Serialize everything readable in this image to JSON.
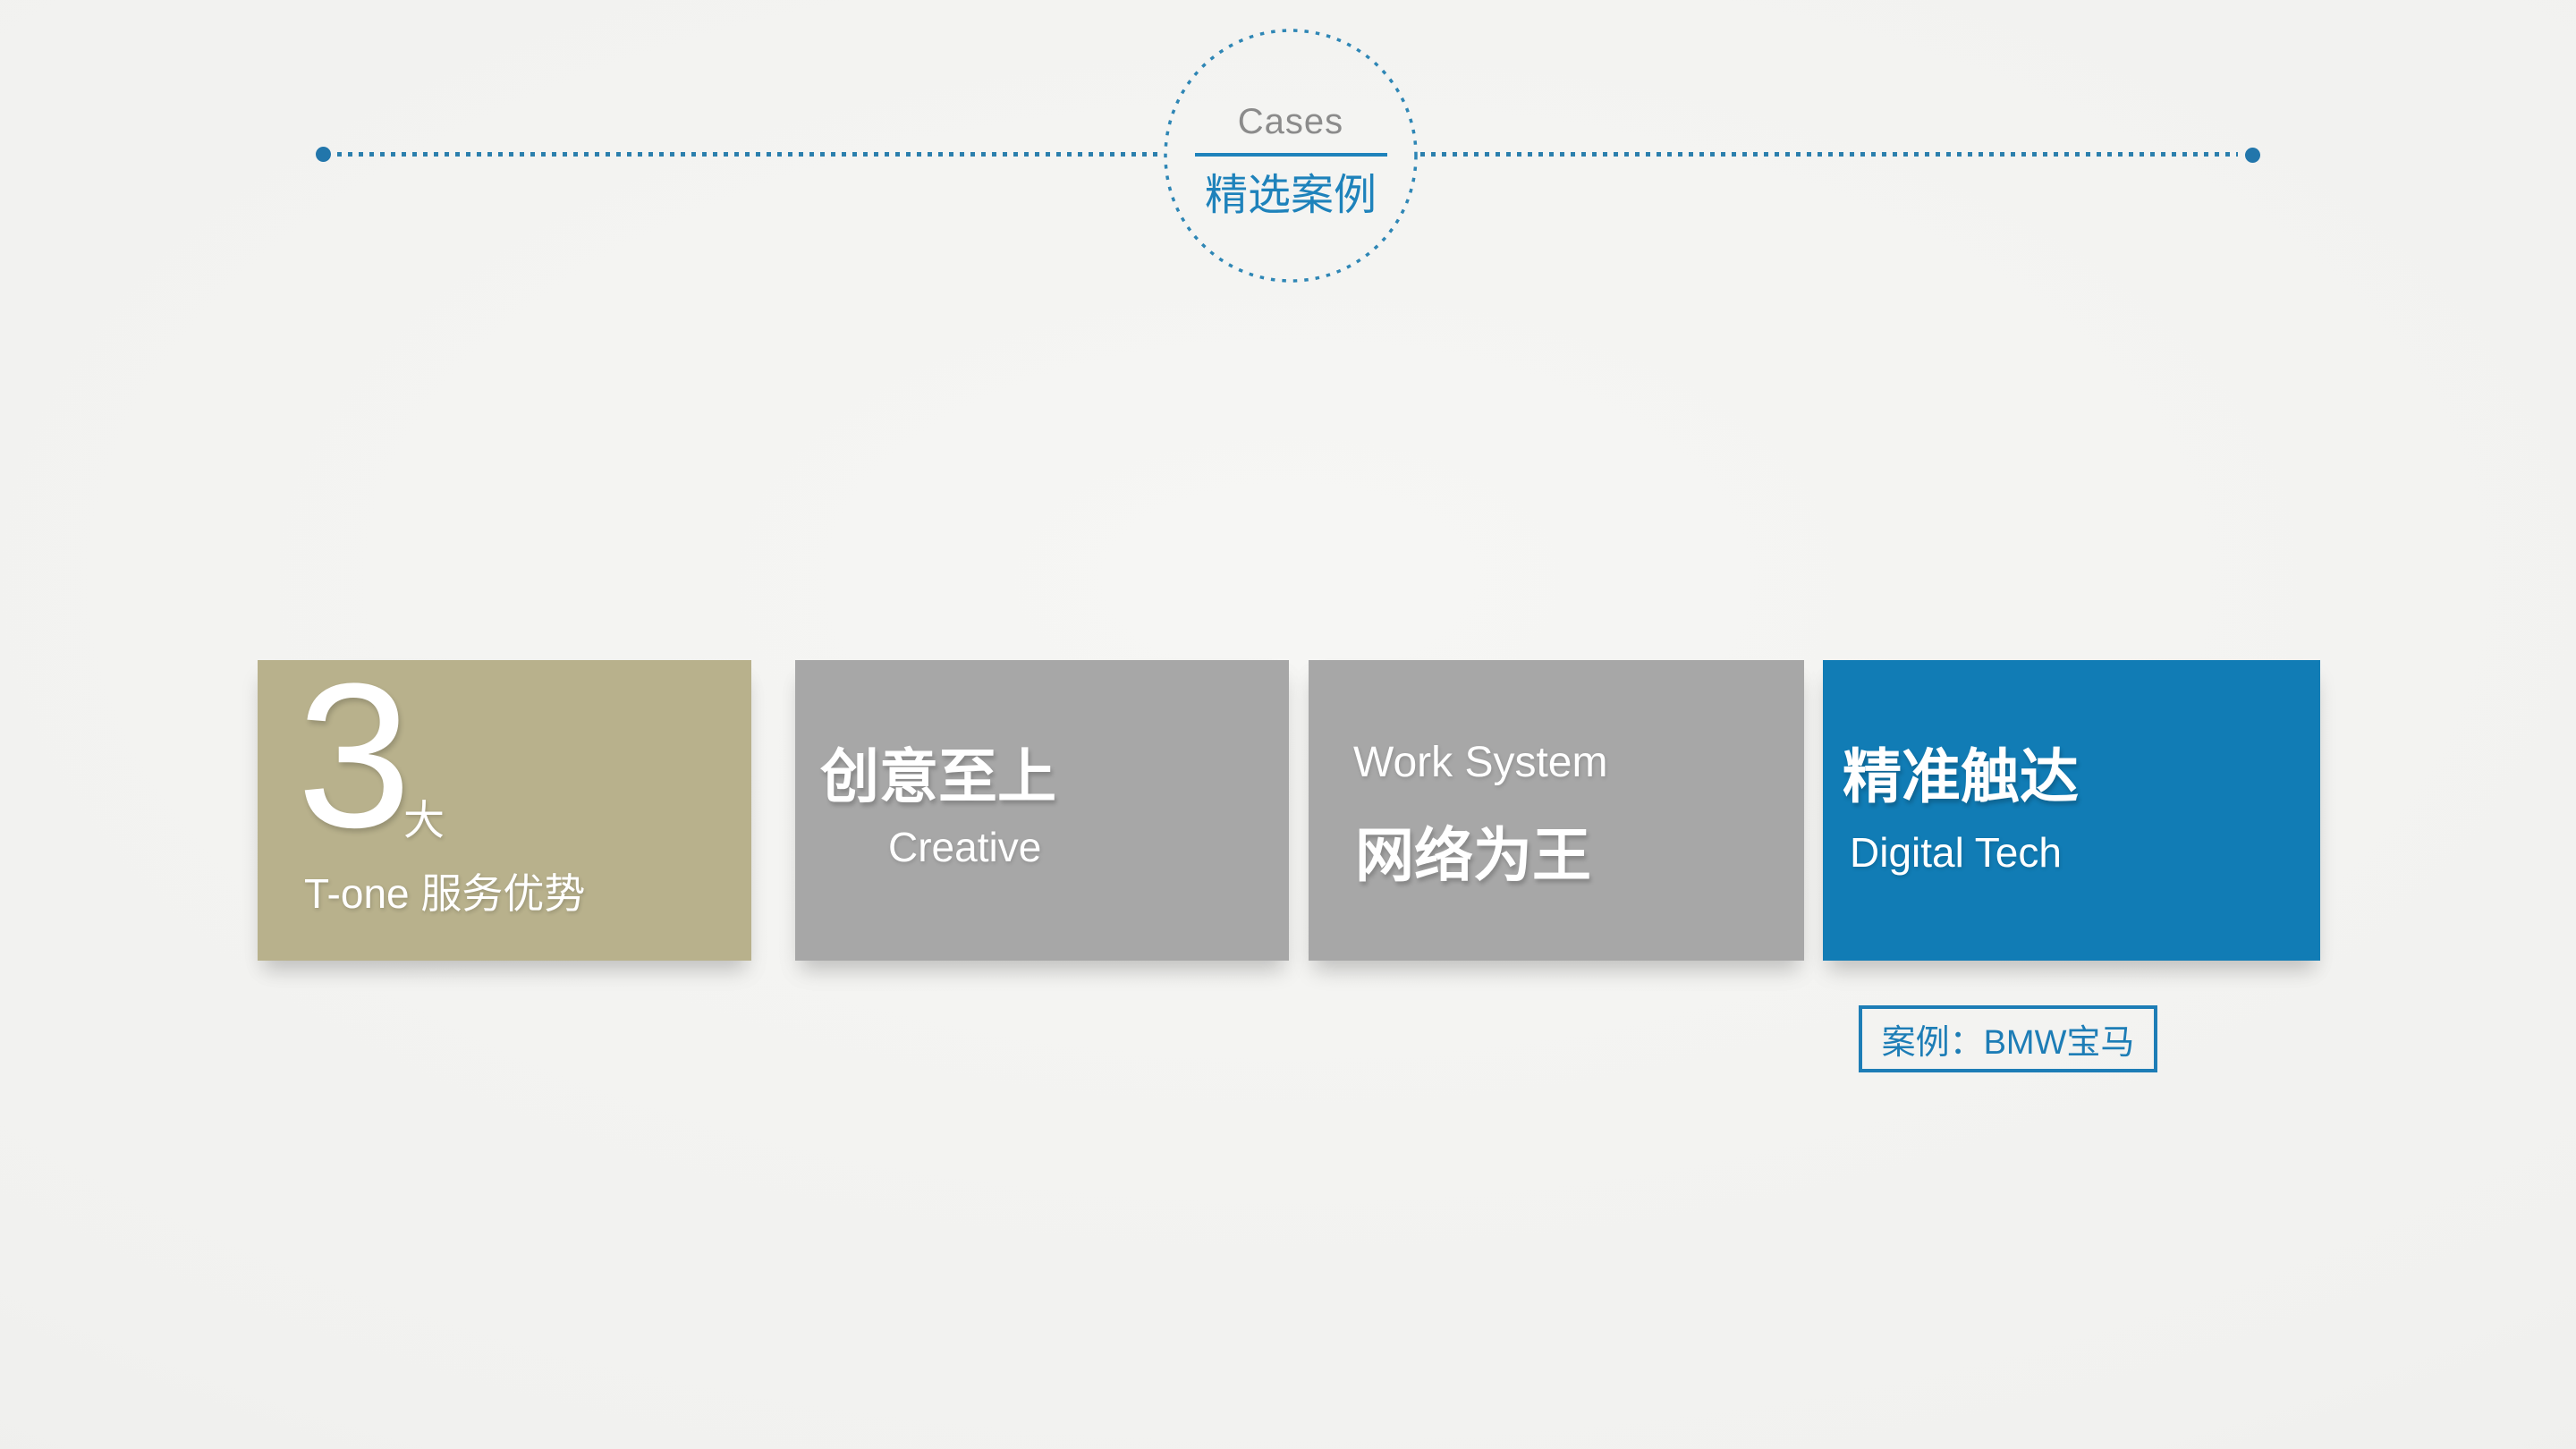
{
  "slide": {
    "header": {
      "title_en": "Cases",
      "title_zh": "精选案例"
    },
    "cards": [
      {
        "number": "3",
        "number_suffix": "大",
        "caption": "T-one 服务优势"
      },
      {
        "title_zh": "创意至上",
        "subtitle_en": "Creative"
      },
      {
        "eyebrow_en": "Work System",
        "title_zh": "网络为王"
      },
      {
        "title_zh": "精准触达",
        "subtitle_en": "Digital Tech"
      }
    ],
    "case_tag": {
      "text": "案例：BMW宝马"
    }
  },
  "colors": {
    "accent_blue": "#117cb5",
    "card_khaki": "#b8b18c",
    "card_gray": "#a7a7a7",
    "rule_blue": "#2b7fad",
    "endpoint_dot_blue": "#2276ab",
    "circle_text_blue": "#1e82bb",
    "header_en_gray": "#8b8b8b",
    "tag_blue": "#1d7db6",
    "background": "#f1f1ef"
  }
}
